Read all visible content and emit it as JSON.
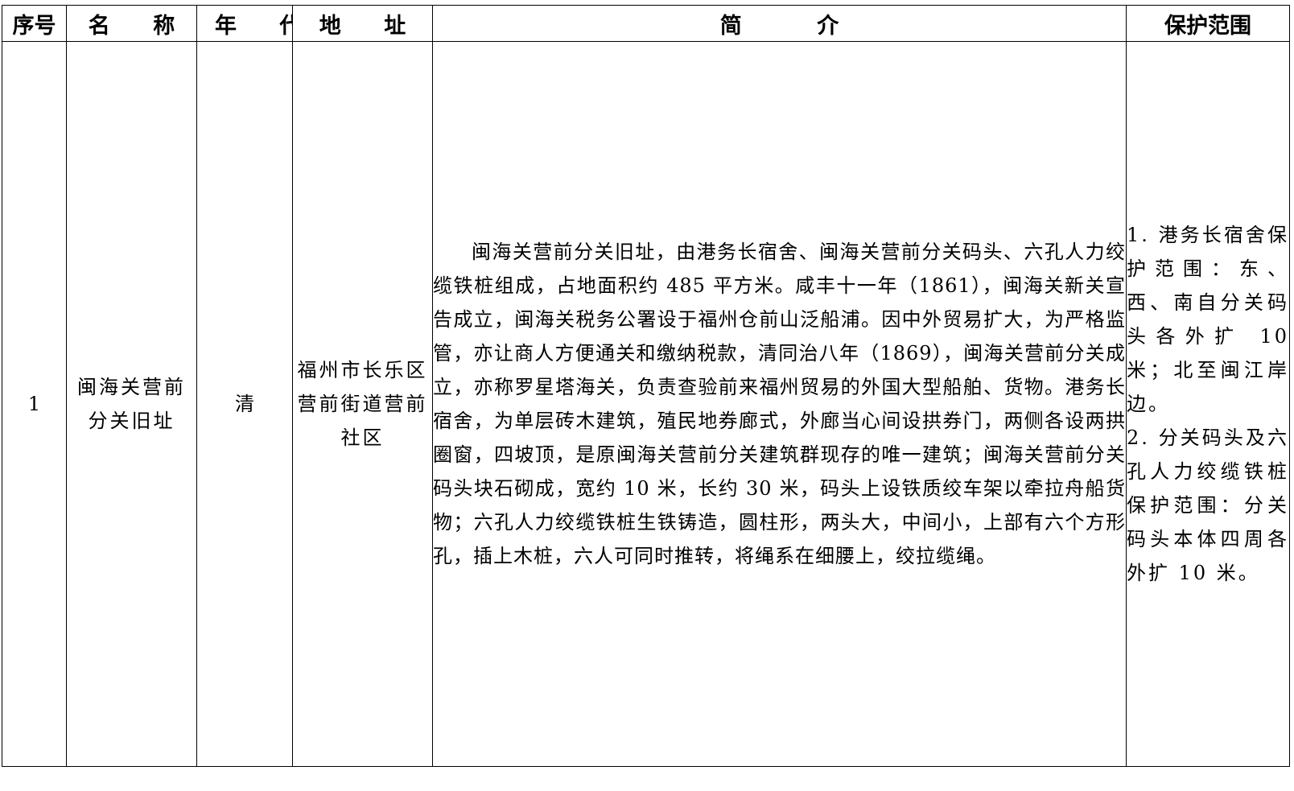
{
  "table": {
    "headers": {
      "index": "序号",
      "name": "名 称",
      "era": "年 代",
      "address": "地 址",
      "intro": "简 介",
      "scope": "保护范围"
    },
    "rows": [
      {
        "index": "1",
        "name": "闽海关营前分关旧址",
        "era": "清",
        "address": "福州市长乐区营前街道营前社区",
        "intro": "闽海关营前分关旧址，由港务长宿舍、闽海关营前分关码头、六孔人力绞缆铁桩组成，占地面积约 485 平方米。咸丰十一年（1861），闽海关新关宣告成立，闽海关税务公署设于福州仓前山泛船浦。因中外贸易扩大，为严格监管，亦让商人方便通关和缴纳税款，清同治八年（1869），闽海关营前分关成立，亦称罗星塔海关，负责查验前来福州贸易的外国大型船舶、货物。港务长宿舍，为单层砖木建筑，殖民地券廊式，外廊当心间设拱券门，两侧各设两拱圈窗，四坡顶，是原闽海关营前分关建筑群现存的唯一建筑；闽海关营前分关码头块石砌成，宽约 10 米，长约 30 米，码头上设铁质绞车架以牵拉舟船货物；六孔人力绞缆铁桩生铁铸造，圆柱形，两头大，中间小，上部有六个方形孔，插上木桩，六人可同时推转，将绳系在细腰上，绞拉缆绳。",
        "scope": [
          "1. 港务长宿舍保护范围：东、西、南自分关码头各外扩 10 米；北至闽江岸边。",
          "2. 分关码头及六孔人力绞缆铁桩保护范围：分关码头本体四周各外扩 10 米。"
        ]
      }
    ]
  }
}
